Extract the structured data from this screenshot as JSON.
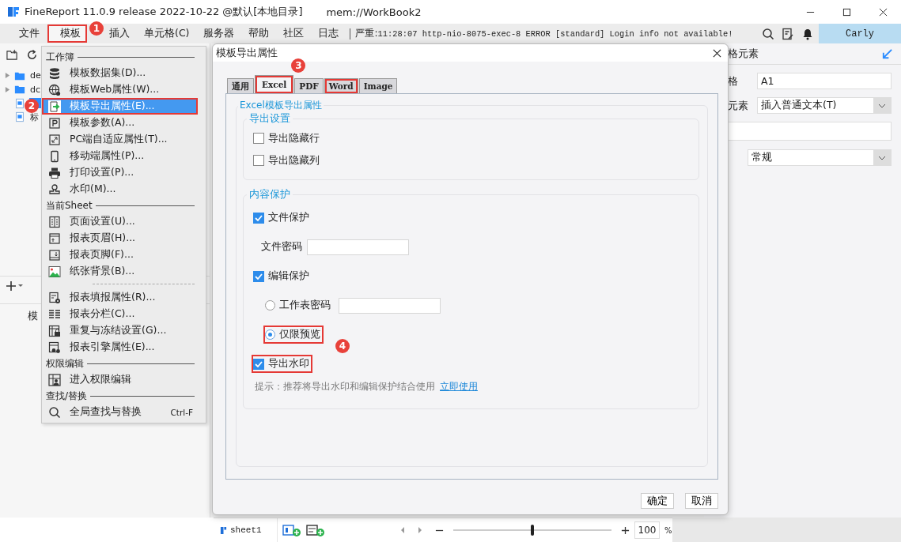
{
  "window": {
    "title": "FineReport 11.0.9 release 2022-10-22 @默认[本地目录]",
    "file": "mem://WorkBook2"
  },
  "menubar": {
    "items": [
      {
        "label": "文件",
        "selected": false,
        "highlighted": false
      },
      {
        "label": "模板",
        "selected": true,
        "highlighted": true,
        "callout": "1"
      },
      {
        "label": "插入",
        "selected": false,
        "highlighted": false
      },
      {
        "label": "单元格(C)",
        "selected": false,
        "highlighted": false
      },
      {
        "label": "服务器",
        "selected": false,
        "highlighted": false
      },
      {
        "label": "帮助",
        "selected": false,
        "highlighted": false
      },
      {
        "label": "社区",
        "selected": false,
        "highlighted": false
      },
      {
        "label": "日志",
        "selected": false,
        "highlighted": false
      }
    ],
    "log_level": "严重:",
    "log": "11:28:07 http-nio-8075-exec-8 ERROR [standard] Login info not available!",
    "user": "Carly"
  },
  "tree": {
    "items": [
      {
        "kind": "folder",
        "label": "de",
        "selected": false
      },
      {
        "kind": "folder",
        "label": "dc",
        "selected": false
      },
      {
        "kind": "file",
        "selected": true
      },
      {
        "kind": "file",
        "label": "标",
        "selected": false
      }
    ],
    "tab": "模"
  },
  "menu": {
    "rows": [
      {
        "kind": "header",
        "label": "工作簿"
      },
      {
        "kind": "item",
        "label": "模板数据集(D)...",
        "selected": false,
        "highlighted": false
      },
      {
        "kind": "item",
        "label": "模板Web属性(W)...",
        "selected": false,
        "highlighted": false
      },
      {
        "kind": "item",
        "label": "模板导出属性(E)...",
        "selected": true,
        "highlighted": true,
        "callout": "2"
      },
      {
        "kind": "item",
        "label": "模板参数(A)...",
        "selected": false,
        "highlighted": false
      },
      {
        "kind": "item",
        "label": "PC端自适应属性(T)...",
        "selected": false,
        "highlighted": false
      },
      {
        "kind": "item",
        "label": "移动端属性(P)...",
        "selected": false,
        "highlighted": false
      },
      {
        "kind": "item",
        "label": "打印设置(P)...",
        "selected": false,
        "highlighted": false
      },
      {
        "kind": "item",
        "label": "水印(M)...",
        "selected": false,
        "highlighted": false
      },
      {
        "kind": "header",
        "label": "当前Sheet"
      },
      {
        "kind": "item",
        "label": "页面设置(U)...",
        "selected": false,
        "highlighted": false
      },
      {
        "kind": "item",
        "label": "报表页眉(H)...",
        "selected": false,
        "highlighted": false
      },
      {
        "kind": "item",
        "label": "报表页脚(F)...",
        "selected": false,
        "highlighted": false
      },
      {
        "kind": "item",
        "label": "纸张背景(B)...",
        "selected": false,
        "highlighted": false
      },
      {
        "kind": "separator"
      },
      {
        "kind": "item",
        "label": "报表填报属性(R)...",
        "selected": false,
        "highlighted": false
      },
      {
        "kind": "item",
        "label": "报表分栏(C)...",
        "selected": false,
        "highlighted": false
      },
      {
        "kind": "item",
        "label": "重复与冻结设置(G)...",
        "selected": false,
        "highlighted": false
      },
      {
        "kind": "item",
        "label": "报表引擎属性(E)...",
        "selected": false,
        "highlighted": false
      },
      {
        "kind": "header",
        "label": "权限编辑"
      },
      {
        "kind": "item",
        "label": "进入权限编辑",
        "selected": false,
        "highlighted": false
      },
      {
        "kind": "header",
        "label": "查找/替换"
      },
      {
        "kind": "item",
        "label": "全局查找与替换",
        "shortcut": "Ctrl-F",
        "selected": false,
        "highlighted": false
      }
    ]
  },
  "dialog": {
    "title": "模板导出属性",
    "tabs": [
      {
        "label": "通用",
        "selected": false,
        "highlighted": false
      },
      {
        "label": "Excel",
        "selected": true,
        "highlighted": true,
        "callout": "3"
      },
      {
        "label": "PDF",
        "selected": false,
        "highlighted": false
      },
      {
        "label": "Word",
        "selected": false,
        "highlighted": true
      },
      {
        "label": "Image",
        "selected": false,
        "highlighted": false
      }
    ],
    "section_title": "Excel模板导出属性",
    "groups": [
      {
        "title": "导出设置",
        "rows": [
          {
            "kind": "checkbox",
            "label": "导出隐藏行",
            "checked": false,
            "highlighted": false
          },
          {
            "kind": "checkbox",
            "label": "导出隐藏列",
            "checked": false,
            "highlighted": false
          }
        ]
      },
      {
        "title": "内容保护",
        "rows": [
          {
            "kind": "checkbox",
            "label": "文件保护",
            "checked": true,
            "highlighted": false
          },
          {
            "kind": "field",
            "label": "文件密码"
          },
          {
            "kind": "checkbox",
            "label": "编辑保护",
            "checked": true,
            "highlighted": false
          },
          {
            "kind": "radio",
            "label": "工作表密码",
            "selected": false,
            "field": true,
            "highlighted": false
          },
          {
            "kind": "radio",
            "label": "仅限预览",
            "selected": true,
            "field": false,
            "highlighted": true,
            "callout": "4"
          },
          {
            "kind": "checkbox",
            "label": "导出水印",
            "checked": true,
            "highlighted": true
          },
          {
            "kind": "hint",
            "text": "提示：推荐将导出水印和编辑保护结合使用",
            "link": "立即使用"
          }
        ]
      }
    ],
    "buttons": [
      "确定",
      "取消"
    ]
  },
  "properties": {
    "header": "格元素",
    "rows": [
      {
        "kind": "input",
        "label": "格",
        "value": "A1"
      },
      {
        "kind": "select",
        "label": "元素",
        "value": "插入普通文本(T)"
      },
      {
        "kind": "input"
      },
      {
        "kind": "select",
        "value": "常规"
      }
    ]
  },
  "sheet_tabs": [
    {
      "label": "sheet1",
      "selected": true
    }
  ],
  "zoom": {
    "level": 0.5,
    "value": "100",
    "unit": "%"
  }
}
